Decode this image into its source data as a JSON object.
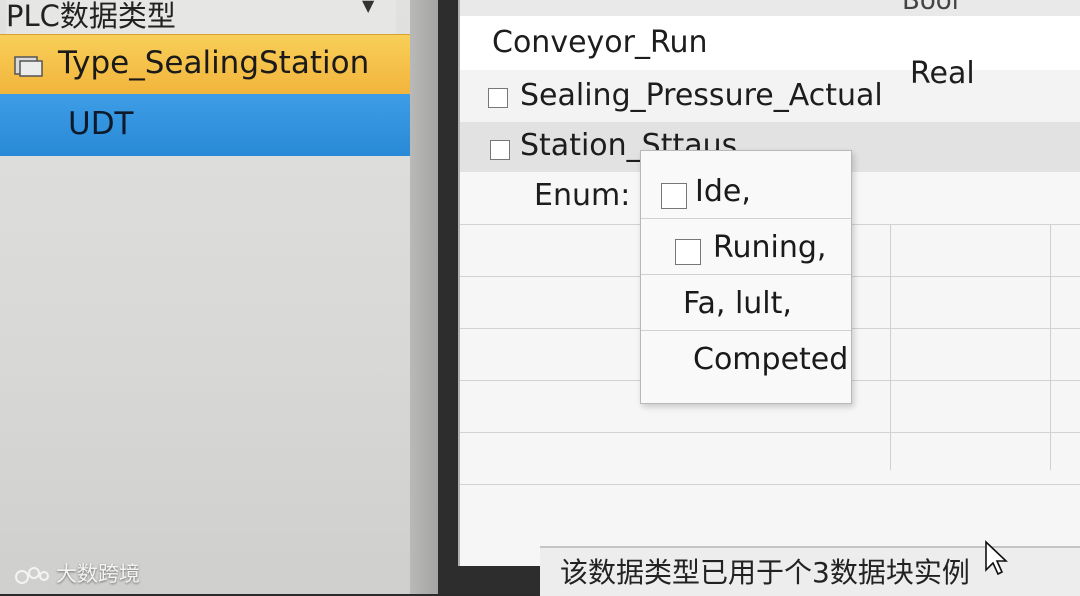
{
  "tree": {
    "panel_title": "PLC数据类型",
    "items": [
      {
        "label": "Type_SealingStation",
        "icon": "folder-icon",
        "state": "highlighted"
      },
      {
        "label": "UDT",
        "state": "selected"
      }
    ]
  },
  "grid": {
    "header": {
      "type_label": "Bool"
    },
    "rows": [
      {
        "name": "Conveyor_Run",
        "type": ""
      },
      {
        "name": "Sealing_Pressure_Actual",
        "type": "Real"
      },
      {
        "name": "Station_Sttaus",
        "type": ""
      }
    ],
    "enum_label": "Enum:"
  },
  "enum_popup": {
    "items": [
      {
        "label": "Ide,",
        "checkbox": true
      },
      {
        "label": "Runing,",
        "checkbox": true
      },
      {
        "label": "Fa, lult,",
        "checkbox": false
      },
      {
        "label": "Competed",
        "checkbox": false
      }
    ]
  },
  "status": {
    "text": "该数据类型已用于个3数据块实例"
  },
  "watermark": {
    "text": "大数跨境"
  },
  "colors": {
    "highlight": "#f2b43c",
    "selection": "#2889d6"
  }
}
